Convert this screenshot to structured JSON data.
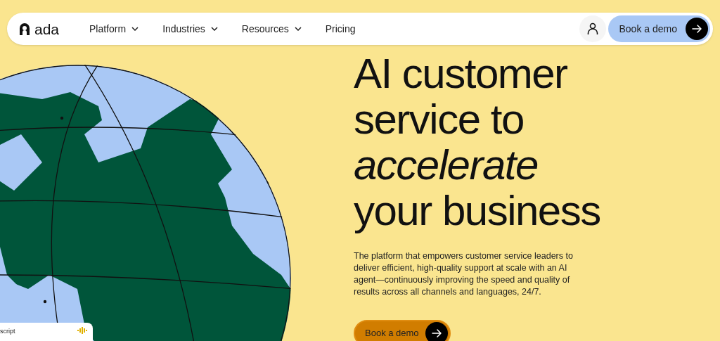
{
  "nav": {
    "logo": "ada",
    "items": [
      {
        "label": "Platform",
        "kind": "dropdown"
      },
      {
        "label": "Industries",
        "kind": "dropdown"
      },
      {
        "label": "Resources",
        "kind": "dropdown"
      },
      {
        "label": "Pricing",
        "kind": "link"
      }
    ],
    "cta": "Book a demo"
  },
  "hero": {
    "headline": [
      {
        "text": "AI customer",
        "italic": false
      },
      {
        "text": "service to",
        "italic": false
      },
      {
        "text": "accelerate",
        "italic": true
      },
      {
        "text": "your business",
        "italic": false
      }
    ],
    "body": "The platform that empowers customer service leaders to deliver efficient, high-quality support at scale with an AI agent—continuously improving the speed and quality of results across all channels and languages, 24/7.",
    "cta": "Book a demo"
  },
  "card": {
    "text": "script"
  }
}
